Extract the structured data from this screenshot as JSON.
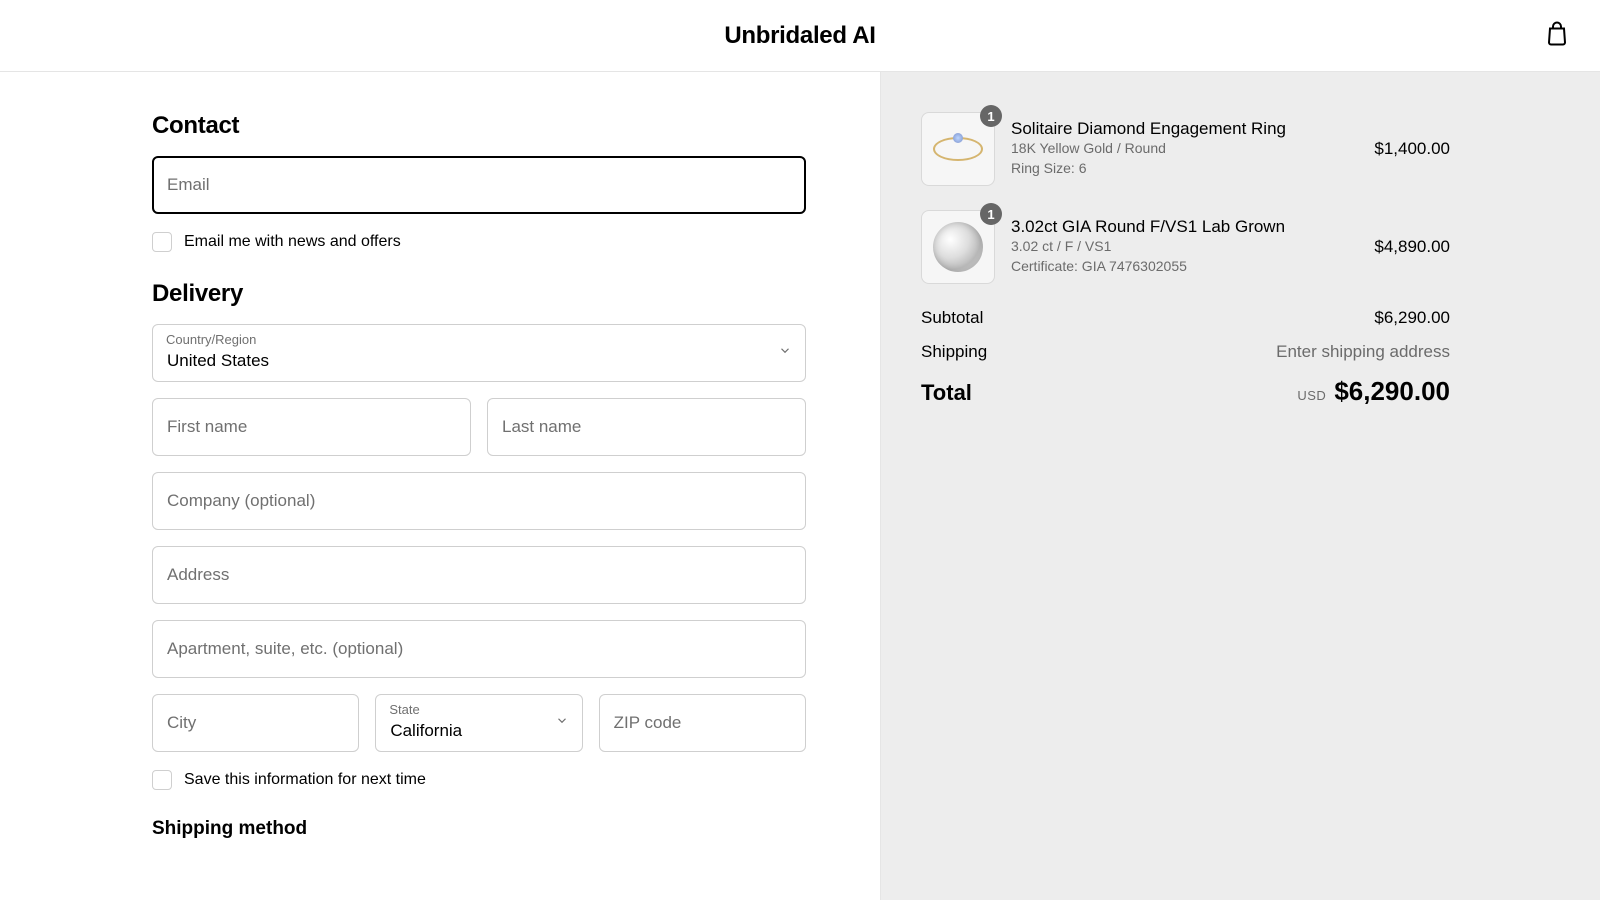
{
  "brand": "Unbridaled AI",
  "contact": {
    "heading": "Contact",
    "email_placeholder": "Email",
    "news_checkbox_label": "Email me with news and offers"
  },
  "delivery": {
    "heading": "Delivery",
    "country_label": "Country/Region",
    "country_value": "United States",
    "first_name_placeholder": "First name",
    "last_name_placeholder": "Last name",
    "company_placeholder": "Company (optional)",
    "address_placeholder": "Address",
    "apartment_placeholder": "Apartment, suite, etc. (optional)",
    "city_placeholder": "City",
    "state_label": "State",
    "state_value": "California",
    "zip_placeholder": "ZIP code",
    "save_info_label": "Save this information for next time"
  },
  "shipping_method_heading": "Shipping method",
  "order": {
    "items": [
      {
        "qty": "1",
        "title": "Solitaire Diamond Engagement Ring",
        "sub1": "18K Yellow Gold / Round",
        "sub2": "Ring Size: 6",
        "price": "$1,400.00"
      },
      {
        "qty": "1",
        "title": "3.02ct GIA Round F/VS1 Lab Grown",
        "sub1": "3.02 ct / F / VS1",
        "sub2": "Certificate: GIA 7476302055",
        "price": "$4,890.00"
      }
    ],
    "subtotal_label": "Subtotal",
    "subtotal_value": "$6,290.00",
    "shipping_label": "Shipping",
    "shipping_value": "Enter shipping address",
    "total_label": "Total",
    "currency": "USD",
    "total_value": "$6,290.00"
  }
}
